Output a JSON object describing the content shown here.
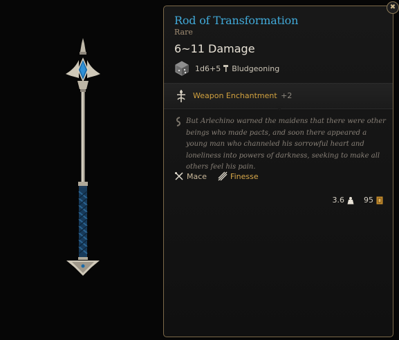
{
  "item": {
    "title": "Rod of Transformation",
    "rarity": "Rare",
    "damage": "6~11 Damage",
    "dice": "1d6+5",
    "damage_type": "Bludgeoning",
    "enchantment_label": "Weapon Enchantment",
    "enchantment_value": "+2",
    "description": "But Arlechino warned the maidens that there were other beings who made pacts, and soon there appeared a young man who channeled his sorrowful heart and loneliness into powers of darkness, seeking to make all others feel his pain.",
    "proficiency": "Mace",
    "property": "Finesse",
    "weight": "3.6",
    "value": "95"
  },
  "close_label": "✖",
  "icons": {
    "close": "close-icon",
    "dice": "d6-dice-icon",
    "damage_type": "hammer-icon",
    "enchantment": "enchantment-icon",
    "description": "scroll-icon",
    "proficiency": "crossed-weapons-icon",
    "finesse": "finesse-icon",
    "weight": "weight-icon",
    "value": "gold-icon"
  },
  "colors": {
    "title": "#41a9d8",
    "rarity": "#a18c73",
    "enchantment": "#d1a13f",
    "finesse": "#d8a84a",
    "border": "#7d6a4a"
  }
}
